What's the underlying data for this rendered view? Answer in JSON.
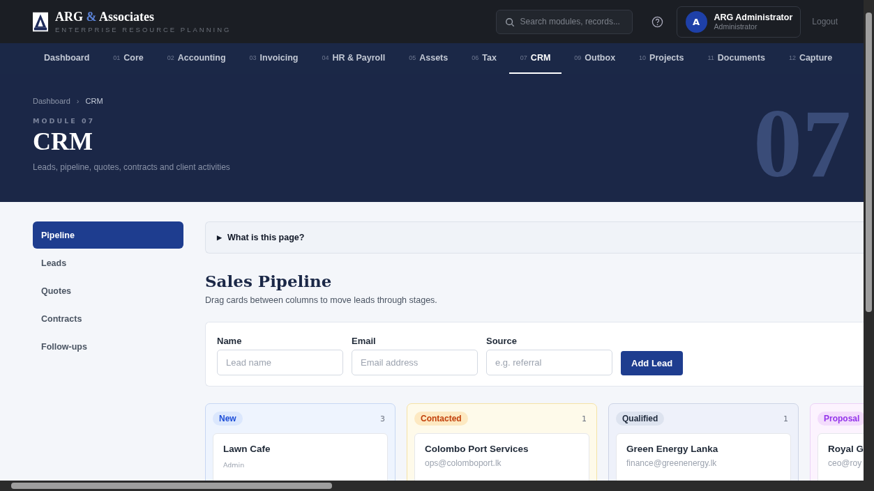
{
  "brand": {
    "name_start": "ARG",
    "ampersand": "&",
    "name_end": "Associates",
    "tagline": "ENTERPRISE RESOURCE PLANNING"
  },
  "search": {
    "placeholder": "Search modules, records..."
  },
  "user": {
    "initial": "A",
    "name": "ARG Administrator",
    "role": "Administrator"
  },
  "logout": "Logout",
  "nav": [
    {
      "label": "Dashboard",
      "selected": false
    },
    {
      "num": "01",
      "label": "Core",
      "selected": false
    },
    {
      "num": "02",
      "label": "Accounting",
      "selected": false
    },
    {
      "num": "03",
      "label": "Invoicing",
      "selected": false
    },
    {
      "num": "04",
      "label": "HR & Payroll",
      "selected": false
    },
    {
      "num": "05",
      "label": "Assets",
      "selected": false
    },
    {
      "num": "06",
      "label": "Tax",
      "selected": false
    },
    {
      "num": "07",
      "label": "CRM",
      "selected": true
    },
    {
      "num": "09",
      "label": "Outbox",
      "selected": false
    },
    {
      "num": "10",
      "label": "Projects",
      "selected": false
    },
    {
      "num": "11",
      "label": "Documents",
      "selected": false
    },
    {
      "num": "12",
      "label": "Capture",
      "selected": false
    }
  ],
  "breadcrumb": {
    "items": [
      "Dashboard",
      "CRM"
    ],
    "separator": "›"
  },
  "hero": {
    "eyebrow": "MODULE 07",
    "title": "CRM",
    "subtitle": "Leads, pipeline, quotes, contracts and client activities",
    "big_number": "07"
  },
  "sidebar": [
    {
      "label": "Pipeline",
      "selected": true
    },
    {
      "label": "Leads",
      "selected": false
    },
    {
      "label": "Quotes",
      "selected": false
    },
    {
      "label": "Contracts",
      "selected": false
    },
    {
      "label": "Follow-ups",
      "selected": false
    }
  ],
  "help": {
    "marker": "▶",
    "label": "What is this page?"
  },
  "section": {
    "title": "Sales Pipeline",
    "subtitle": "Drag cards between columns to move leads through stages."
  },
  "form": {
    "fields": [
      {
        "label": "Name",
        "placeholder": "Lead name"
      },
      {
        "label": "Email",
        "placeholder": "Email address"
      },
      {
        "label": "Source",
        "placeholder": "e.g. referral"
      }
    ],
    "button": "Add Lead"
  },
  "columns": [
    {
      "stage": "New",
      "count": "3",
      "color": "#1d4ed8",
      "cards": [
        {
          "name": "Lawn Cafe",
          "sub": "Admin",
          "kind": "small"
        }
      ]
    },
    {
      "stage": "Contacted",
      "count": "1",
      "color": "#c2410c",
      "cards": [
        {
          "name": "Colombo Port Services",
          "sub": "ops@colomboport.lk",
          "kind": "email"
        }
      ]
    },
    {
      "stage": "Qualified",
      "count": "1",
      "color": "#1e293b",
      "cards": [
        {
          "name": "Green Energy Lanka",
          "sub": "finance@greenenergy.lk",
          "kind": "email"
        }
      ]
    },
    {
      "stage": "Proposal",
      "color": "#9333ea",
      "cards": [
        {
          "name": "Royal G",
          "sub": "ceo@roy",
          "kind": "email"
        }
      ]
    }
  ]
}
